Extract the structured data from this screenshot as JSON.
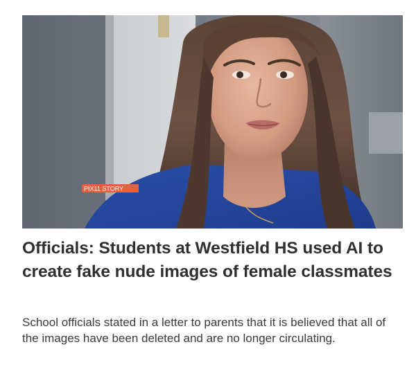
{
  "article": {
    "image": {
      "alt": "",
      "chyron_text": "PIX11 STORY",
      "chyron_color": "#e2623f"
    },
    "headline": "Officials: Students at Westfield HS used AI to create fake nude images of female classmates",
    "summary": "School officials stated in a letter to parents that it is believed that all of the images have been deleted and are no longer circulating."
  },
  "colors": {
    "headline": "#2f2f2f",
    "summary": "#3a3a3a",
    "background": "#ffffff"
  }
}
